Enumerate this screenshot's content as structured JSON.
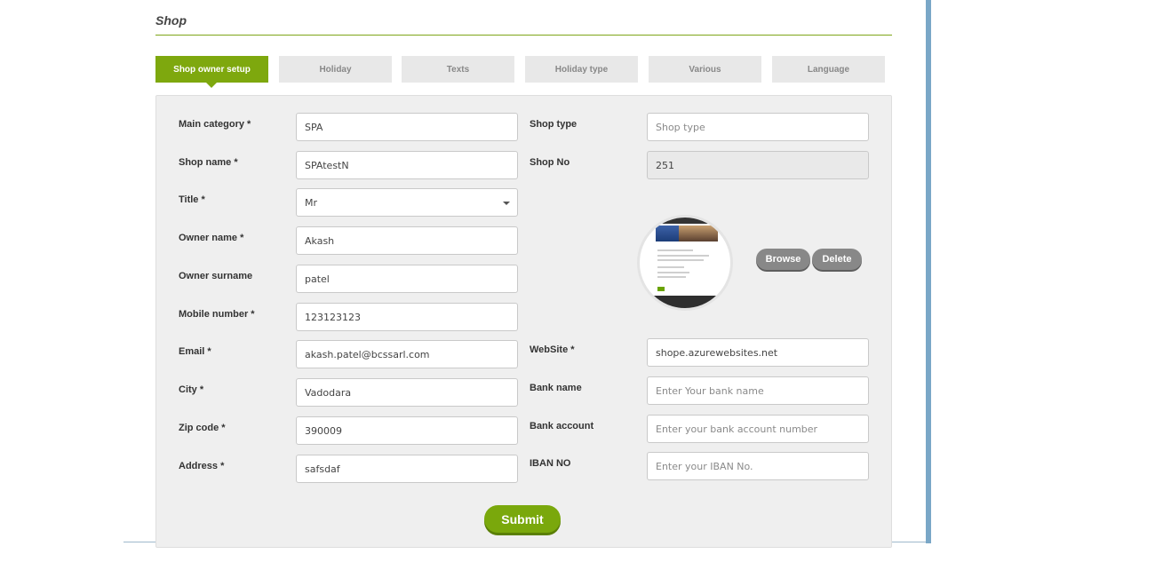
{
  "page": {
    "title": "Shop"
  },
  "tabs": [
    {
      "label": "Shop owner setup",
      "active": true
    },
    {
      "label": "Holiday"
    },
    {
      "label": "Texts"
    },
    {
      "label": "Holiday type"
    },
    {
      "label": "Various"
    },
    {
      "label": "Language"
    }
  ],
  "form": {
    "main_category": {
      "label": "Main category *",
      "value": "SPA"
    },
    "shop_name": {
      "label": "Shop name *",
      "value": "SPAtestN"
    },
    "title": {
      "label": "Title *",
      "value": "Mr"
    },
    "owner_name": {
      "label": "Owner name *",
      "value": "Akash"
    },
    "owner_surname": {
      "label": "Owner surname",
      "value": "patel"
    },
    "mobile_number": {
      "label": "Mobile number *",
      "value": "123123123"
    },
    "email": {
      "label": "Email *",
      "value": "akash.patel@bcssarl.com"
    },
    "city": {
      "label": "City *",
      "value": "Vadodara"
    },
    "zip_code": {
      "label": "Zip code *",
      "value": "390009"
    },
    "address": {
      "label": "Address *",
      "value": "safsdaf"
    },
    "shop_type": {
      "label": "Shop type",
      "placeholder": "Shop type"
    },
    "shop_no": {
      "label": "Shop No",
      "value": "251"
    },
    "website": {
      "label": "WebSite *",
      "value": "shope.azurewebsites.net"
    },
    "bank_name": {
      "label": "Bank name",
      "placeholder": "Enter Your bank name"
    },
    "bank_account": {
      "label": "Bank account",
      "placeholder": "Enter your bank account number"
    },
    "iban": {
      "label": "IBAN NO",
      "placeholder": "Enter your IBAN No."
    }
  },
  "image_actions": {
    "browse": "Browse",
    "delete": "Delete"
  },
  "submit_label": "Submit",
  "colors": {
    "accent": "#7ea80e",
    "tab_inactive": "#e8e8e8",
    "panel": "#efefef",
    "side_bar": "#7aa7c7",
    "pill": "#888888"
  }
}
